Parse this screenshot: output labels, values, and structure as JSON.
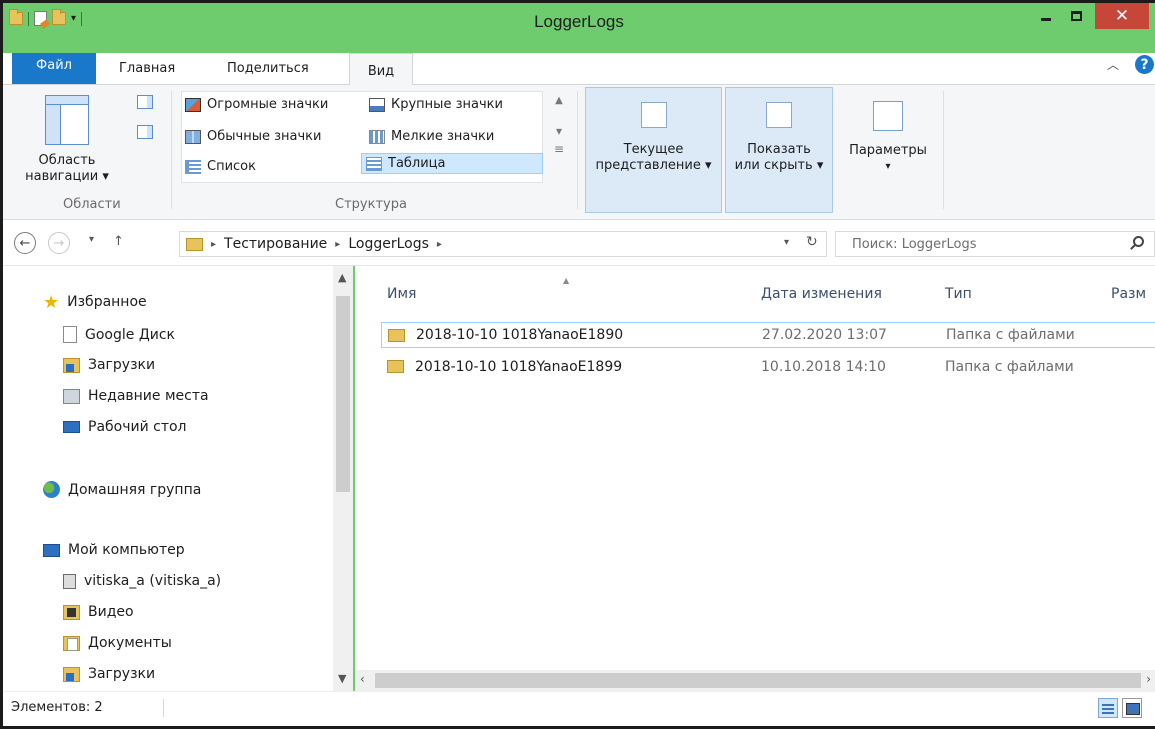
{
  "window": {
    "title": "LoggerLogs"
  },
  "ribbon": {
    "tabs": {
      "file": "Файл",
      "home": "Главная",
      "share": "Поделиться",
      "view": "Вид"
    },
    "panes": {
      "nav_pane_line1": "Область",
      "nav_pane_line2": "навигации ▾",
      "group_label": "Области"
    },
    "layout": {
      "huge_icons": "Огромные значки",
      "large_icons": "Крупные значки",
      "normal_icons": "Обычные значки",
      "small_icons": "Мелкие значки",
      "list": "Список",
      "details": "Таблица",
      "group_label": "Структура"
    },
    "current_view_line1": "Текущее",
    "current_view_line2": "представление ▾",
    "show_hide_line1": "Показать",
    "show_hide_line2": "или скрыть ▾",
    "options_label": "Параметры",
    "options_arrow": "▾"
  },
  "address": {
    "crumbs": [
      "Тестирование",
      "LoggerLogs"
    ],
    "search_placeholder": "Поиск: LoggerLogs"
  },
  "nav_pane": {
    "favorites": "Избранное",
    "google_drive": "Google Диск",
    "downloads": "Загрузки",
    "recent": "Недавние места",
    "desktop": "Рабочий стол",
    "homegroup": "Домашняя группа",
    "computer": "Мой компьютер",
    "user_drive": "vitiska_a (vitiska_a)",
    "videos": "Видео",
    "documents": "Документы",
    "downloads2": "Загрузки"
  },
  "columns": {
    "name": "Имя",
    "date": "Дата изменения",
    "type": "Тип",
    "size": "Разм"
  },
  "files": [
    {
      "name": "2018-10-10 1018YanaoE1890",
      "date": "27.02.2020 13:07",
      "type": "Папка с файлами"
    },
    {
      "name": "2018-10-10 1018YanaoE1899",
      "date": "10.10.2018 14:10",
      "type": "Папка с файлами"
    }
  ],
  "status": {
    "count": "Элементов: 2"
  }
}
